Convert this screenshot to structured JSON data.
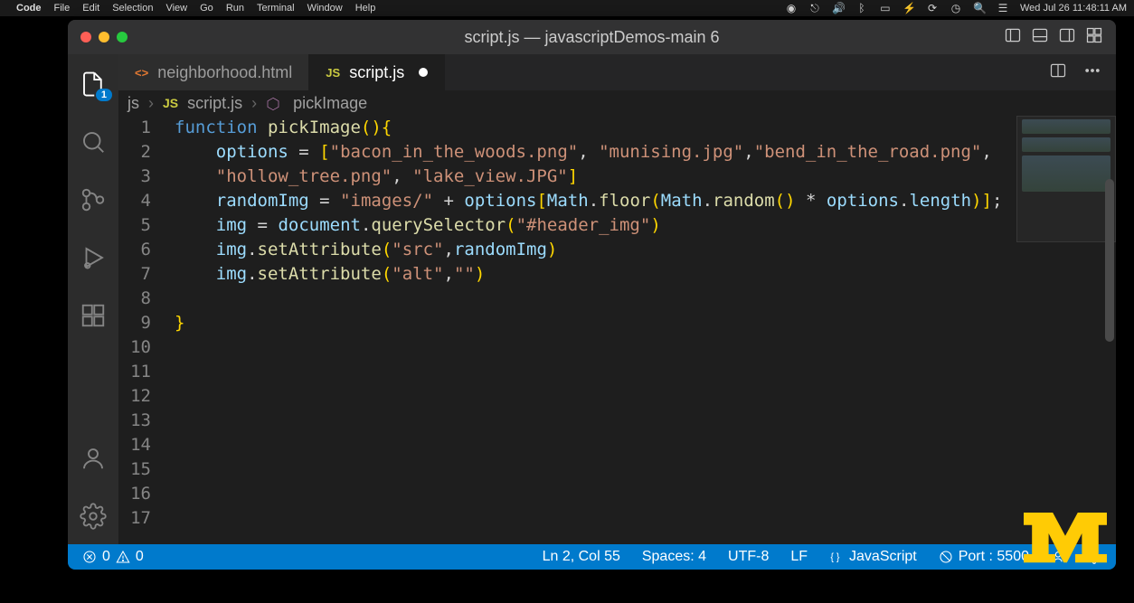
{
  "menubar": {
    "app": "Code",
    "items": [
      "File",
      "Edit",
      "Selection",
      "View",
      "Go",
      "Run",
      "Terminal",
      "Window",
      "Help"
    ],
    "clock": "Wed Jul 26  11:48:11 AM"
  },
  "window": {
    "title": "script.js — javascriptDemos-main 6"
  },
  "activity": {
    "explorer_badge": "1"
  },
  "tabs": [
    {
      "lang": "<>",
      "label": "neighborhood.html",
      "active": false,
      "langClass": "html"
    },
    {
      "lang": "JS",
      "label": "script.js",
      "active": true,
      "dirty": true,
      "langClass": "js"
    }
  ],
  "breadcrumb": {
    "root": "js",
    "file_lang": "JS",
    "file": "script.js",
    "symbol": "pickImage"
  },
  "code": {
    "fn_keyword": "function",
    "fn_name": "pickImage",
    "options_var": "options",
    "arr_items": [
      "\"bacon_in_the_woods.png\"",
      "\"munising.jpg\"",
      "\"bend_in_the_road.png\"",
      "\"hollow_tree.png\"",
      "\"lake_view.JPG\""
    ],
    "rand_var": "randomImg",
    "img_prefix": "\"images/\"",
    "math_floor": "Math",
    "floor": "floor",
    "random": "random",
    "length": "length",
    "img_var": "img",
    "doc": "document",
    "qs": "querySelector",
    "qs_arg": "\"#header_img\"",
    "setAttr": "setAttribute",
    "src": "\"src\"",
    "alt": "\"alt\"",
    "empty": "\"\""
  },
  "line_numbers": [
    "1",
    "2",
    "",
    "3",
    "4",
    "5",
    "6",
    "7",
    "8",
    "9",
    "10",
    "11",
    "12",
    "13",
    "14",
    "15",
    "16",
    "17"
  ],
  "status": {
    "errors": "0",
    "warnings": "0",
    "pos": "Ln 2, Col 55",
    "spaces": "Spaces: 4",
    "encoding": "UTF-8",
    "eol": "LF",
    "lang": "JavaScript",
    "port": "Port : 5500"
  }
}
